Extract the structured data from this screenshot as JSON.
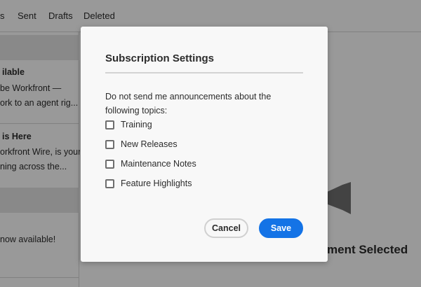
{
  "nav": {
    "tabs": [
      {
        "label": "s"
      },
      {
        "label": "Sent"
      },
      {
        "label": "Drafts"
      },
      {
        "label": "Deleted"
      }
    ]
  },
  "sidebar": {
    "items": [
      {
        "title": "ilable",
        "lines": [
          "be Workfront —",
          "ork to an agent rig..."
        ]
      },
      {
        "title": "is Here",
        "lines": [
          "orkfront Wire, is your",
          "ning across the..."
        ]
      },
      {
        "title": "",
        "lines": [
          "now available!"
        ]
      }
    ]
  },
  "main": {
    "empty_label": "ment Selected",
    "icon": "megaphone-icon"
  },
  "modal": {
    "title": "Subscription Settings",
    "description": "Do not send me announcements about the following topics:",
    "options": [
      {
        "label": "Training",
        "checked": false
      },
      {
        "label": "New Releases",
        "checked": false
      },
      {
        "label": "Maintenance Notes",
        "checked": false
      },
      {
        "label": "Feature Highlights",
        "checked": false
      }
    ],
    "cancel_label": "Cancel",
    "save_label": "Save"
  },
  "colors": {
    "accent": "#1473e6",
    "overlay": "rgba(0,0,0,0.4)"
  }
}
